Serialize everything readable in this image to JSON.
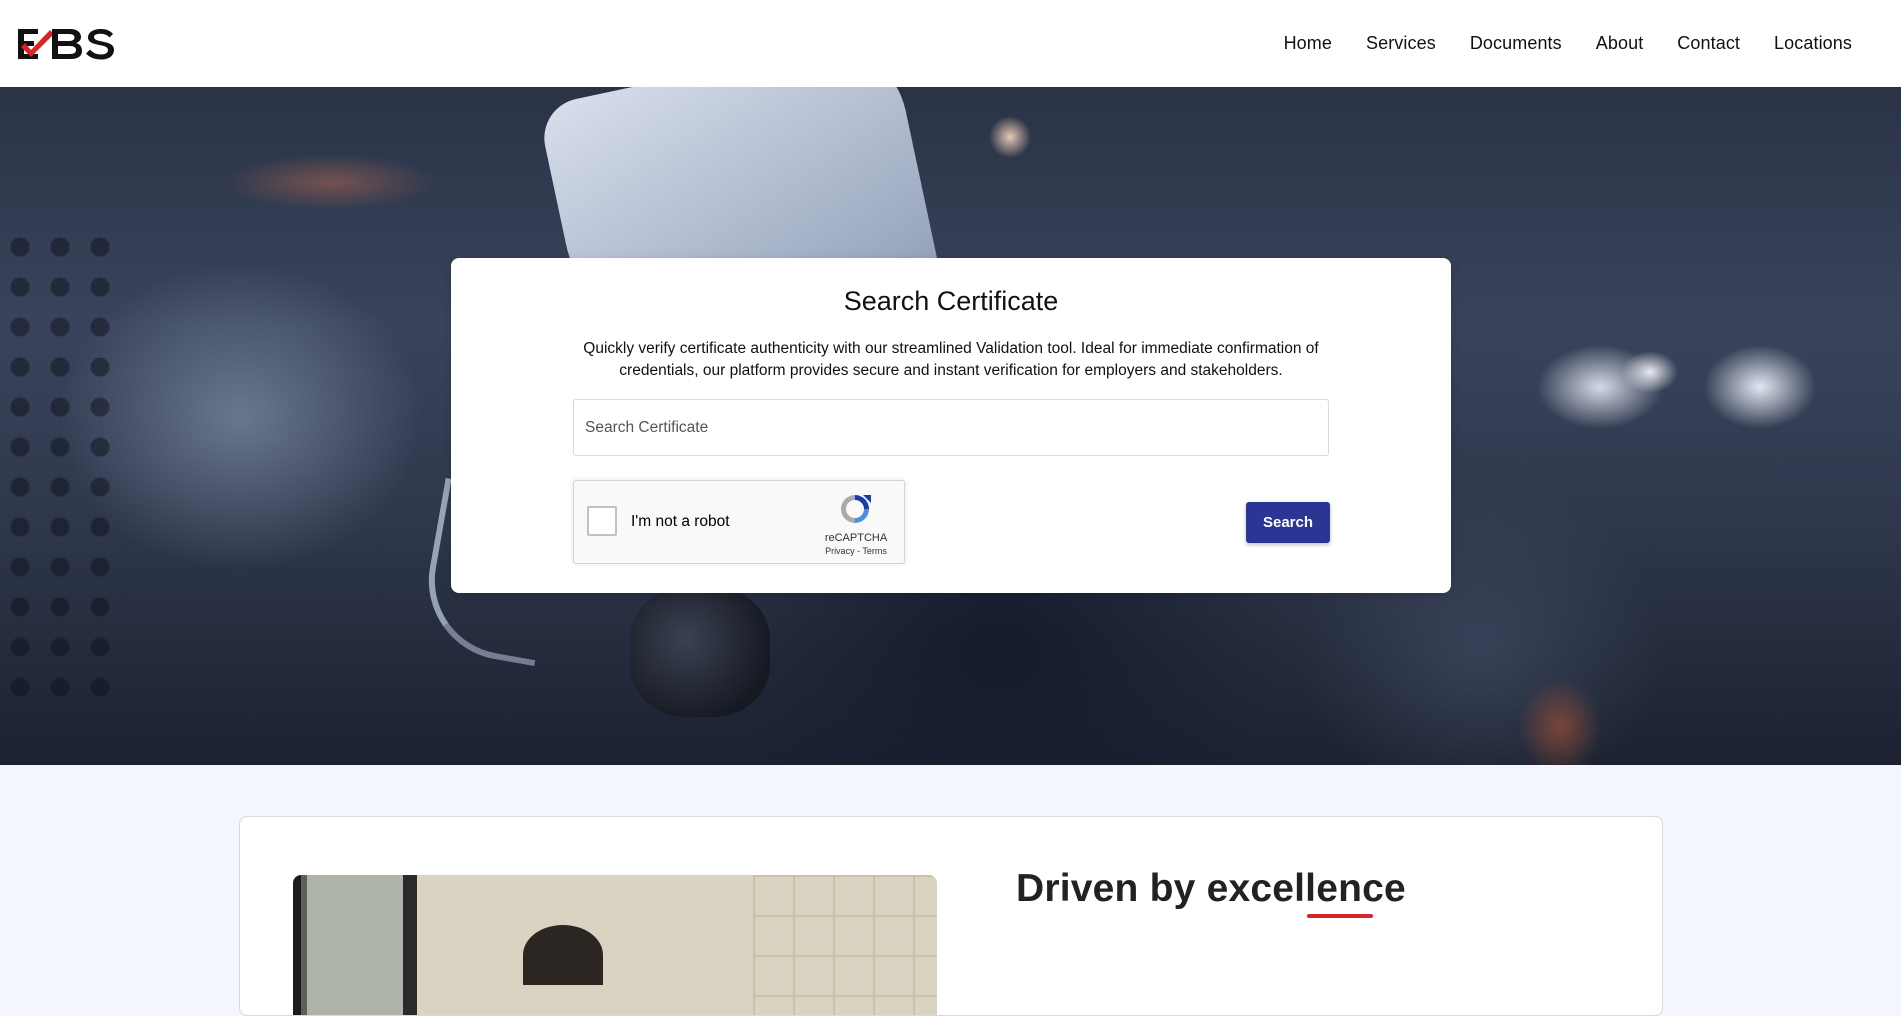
{
  "header": {
    "logo_alt": "EBS",
    "nav": [
      {
        "label": "Home"
      },
      {
        "label": "Services"
      },
      {
        "label": "Documents"
      },
      {
        "label": "About"
      },
      {
        "label": "Contact"
      },
      {
        "label": "Locations"
      }
    ]
  },
  "search": {
    "title": "Search Certificate",
    "description": "Quickly verify certificate authenticity with our streamlined Validation tool. Ideal for immediate confirmation of credentials, our platform provides secure and instant verification for employers and stakeholders.",
    "input_placeholder": "Search Certificate",
    "input_value": "",
    "button_label": "Search"
  },
  "recaptcha": {
    "label": "I'm not a robot",
    "brand": "reCAPTCHA",
    "privacy": "Privacy",
    "separator": " - ",
    "terms": "Terms",
    "checked": false
  },
  "about": {
    "title": "Driven by excellence"
  },
  "colors": {
    "brand_red": "#d8232a",
    "button_blue": "#2b3594",
    "page_bg": "#f3f7fd"
  },
  "icons": {
    "logo": "ebs-logo-checkmark",
    "recaptcha": "recaptcha-logo-icon"
  }
}
